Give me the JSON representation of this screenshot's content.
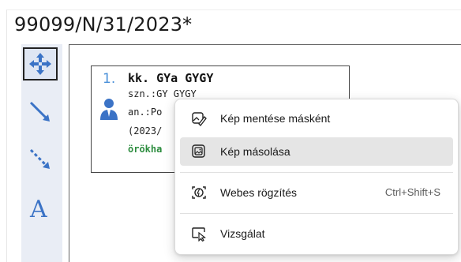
{
  "document": {
    "title": "99099/N/31/2023*"
  },
  "toolbar": {
    "tools": [
      {
        "name": "move",
        "icon": "move-arrows-icon",
        "selected": true
      },
      {
        "name": "line",
        "icon": "diagonal-line-icon"
      },
      {
        "name": "arrow",
        "icon": "dashed-arrow-icon"
      },
      {
        "name": "text",
        "icon": "text-tool-icon",
        "glyph": "A"
      }
    ]
  },
  "card": {
    "number": "1.",
    "name": "kk. GYa GYGY",
    "szn": "szn.:GY GYGY",
    "an": "an.:Po",
    "date": "(2023/",
    "status": "örökha",
    "icon": "person-icon"
  },
  "context_menu": {
    "items": [
      {
        "label": "Kép mentése másként",
        "icon": "save-image-icon"
      },
      {
        "label": "Kép másolása",
        "icon": "copy-image-icon",
        "highlighted": true
      },
      {
        "label": "Webes rögzítés",
        "icon": "web-capture-icon",
        "shortcut": "Ctrl+Shift+S"
      },
      {
        "label": "Vizsgálat",
        "icon": "inspect-icon"
      }
    ]
  },
  "colors": {
    "accent_blue": "#3b73c6",
    "status_green": "#2c8c3e",
    "toolbar_bg": "#e9edf5",
    "menu_hover": "#e5e5e5"
  }
}
